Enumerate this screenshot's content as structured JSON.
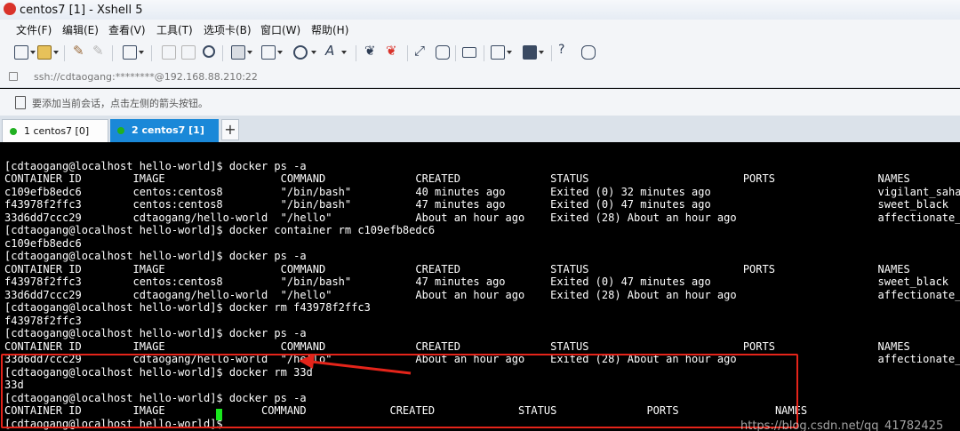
{
  "window": {
    "title": "centos7 [1] - Xshell 5"
  },
  "menu": [
    "文件(F)",
    "编辑(E)",
    "查看(V)",
    "工具(T)",
    "选项卡(B)",
    "窗口(W)",
    "帮助(H)"
  ],
  "address": {
    "url": "ssh://cdtaogang:********@192.168.88.210:22"
  },
  "info": {
    "text": "要添加当前会话，点击左侧的箭头按钮。"
  },
  "tabs": [
    {
      "label": "1 centos7 [0]",
      "active": false,
      "status_color": "#21b021"
    },
    {
      "label": "2 centos7 [1]",
      "active": true,
      "status_color": "#21b021"
    }
  ],
  "terminal": {
    "lines": [
      "[cdtaogang@localhost hello-world]$ docker ps -a",
      "CONTAINER ID        IMAGE                  COMMAND              CREATED              STATUS                        PORTS                NAMES",
      "c109efb8edc6        centos:centos8         \"/bin/bash\"          40 minutes ago       Exited (0) 32 minutes ago                          vigilant_saha",
      "f43978f2ffc3        centos:centos8         \"/bin/bash\"          47 minutes ago       Exited (0) 47 minutes ago                          sweet_black",
      "33d6dd7ccc29        cdtaogang/hello-world  \"/hello\"             About an hour ago    Exited (28) About an hour ago                      affectionate_taussig",
      "[cdtaogang@localhost hello-world]$ docker container rm c109efb8edc6",
      "c109efb8edc6",
      "[cdtaogang@localhost hello-world]$ docker ps -a",
      "CONTAINER ID        IMAGE                  COMMAND              CREATED              STATUS                        PORTS                NAMES",
      "f43978f2ffc3        centos:centos8         \"/bin/bash\"          47 minutes ago       Exited (0) 47 minutes ago                          sweet_black",
      "33d6dd7ccc29        cdtaogang/hello-world  \"/hello\"             About an hour ago    Exited (28) About an hour ago                      affectionate_taussig",
      "[cdtaogang@localhost hello-world]$ docker rm f43978f2ffc3",
      "f43978f2ffc3",
      "[cdtaogang@localhost hello-world]$ docker ps -a",
      "CONTAINER ID        IMAGE                  COMMAND              CREATED              STATUS                        PORTS                NAMES",
      "33d6dd7ccc29        cdtaogang/hello-world  \"/hello\"             About an hour ago    Exited (28) About an hour ago                      affectionate_taussig",
      "[cdtaogang@localhost hello-world]$ docker rm 33d",
      "33d",
      "[cdtaogang@localhost hello-world]$ docker ps -a",
      "CONTAINER ID        IMAGE               COMMAND             CREATED             STATUS              PORTS               NAMES",
      "[cdtaogang@localhost hello-world]$ "
    ],
    "background": "#000000",
    "foreground": "#ffffff",
    "cursor_color": "#19e61d"
  },
  "annotation": {
    "color": "#e4241a"
  },
  "watermark": "https://blog.csdn.net/qq_41782425"
}
